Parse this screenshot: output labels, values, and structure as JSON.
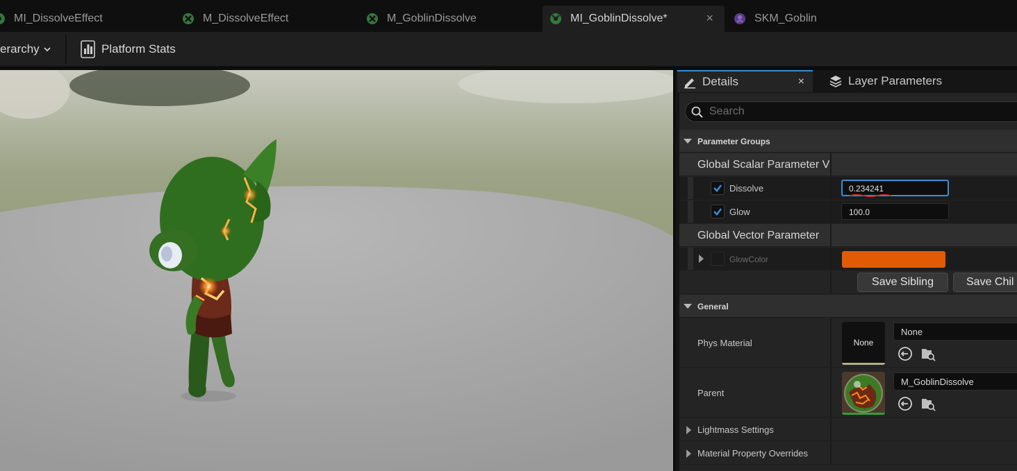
{
  "tabs": [
    {
      "label": "MI_DissolveEffect",
      "icon": "material-instance-icon"
    },
    {
      "label": "M_DissolveEffect",
      "icon": "material-icon"
    },
    {
      "label": "M_GoblinDissolve",
      "icon": "material-icon"
    },
    {
      "label": "MI_GoblinDissolve*",
      "icon": "material-instance-icon",
      "active": true,
      "close": "×"
    },
    {
      "label": "SKM_Goblin",
      "icon": "skeletal-mesh-icon"
    }
  ],
  "toolbar": {
    "hierarchy_label": "erarchy",
    "platform_stats_label": "Platform Stats"
  },
  "details": {
    "tab_details": "Details",
    "tab_close": "×",
    "tab_layer_parameters": "Layer Parameters",
    "search_placeholder": "Search",
    "parameter_groups": "Parameter Groups",
    "global_scalar": "Global Scalar Parameter V",
    "dissolve": {
      "label": "Dissolve",
      "value": "0.234241",
      "checked": true
    },
    "glow": {
      "label": "Glow",
      "value": "100.0",
      "checked": true
    },
    "global_vector": "Global Vector Parameter",
    "glow_color": {
      "label": "GlowColor",
      "color": "#e35a05"
    },
    "save_sibling": "Save Sibling",
    "save_child": "Save Chil",
    "general": "General",
    "phys_material": {
      "label": "Phys Material",
      "thumb_text": "None",
      "value": "None"
    },
    "parent": {
      "label": "Parent",
      "value": "M_GoblinDissolve"
    },
    "lightmass": "Lightmass Settings",
    "material_overrides": "Material Property Overrides"
  },
  "colors": {
    "accent": "#3a8fd9",
    "glow_color": "#e35a05",
    "goblin_green": "#2f6e1e"
  }
}
